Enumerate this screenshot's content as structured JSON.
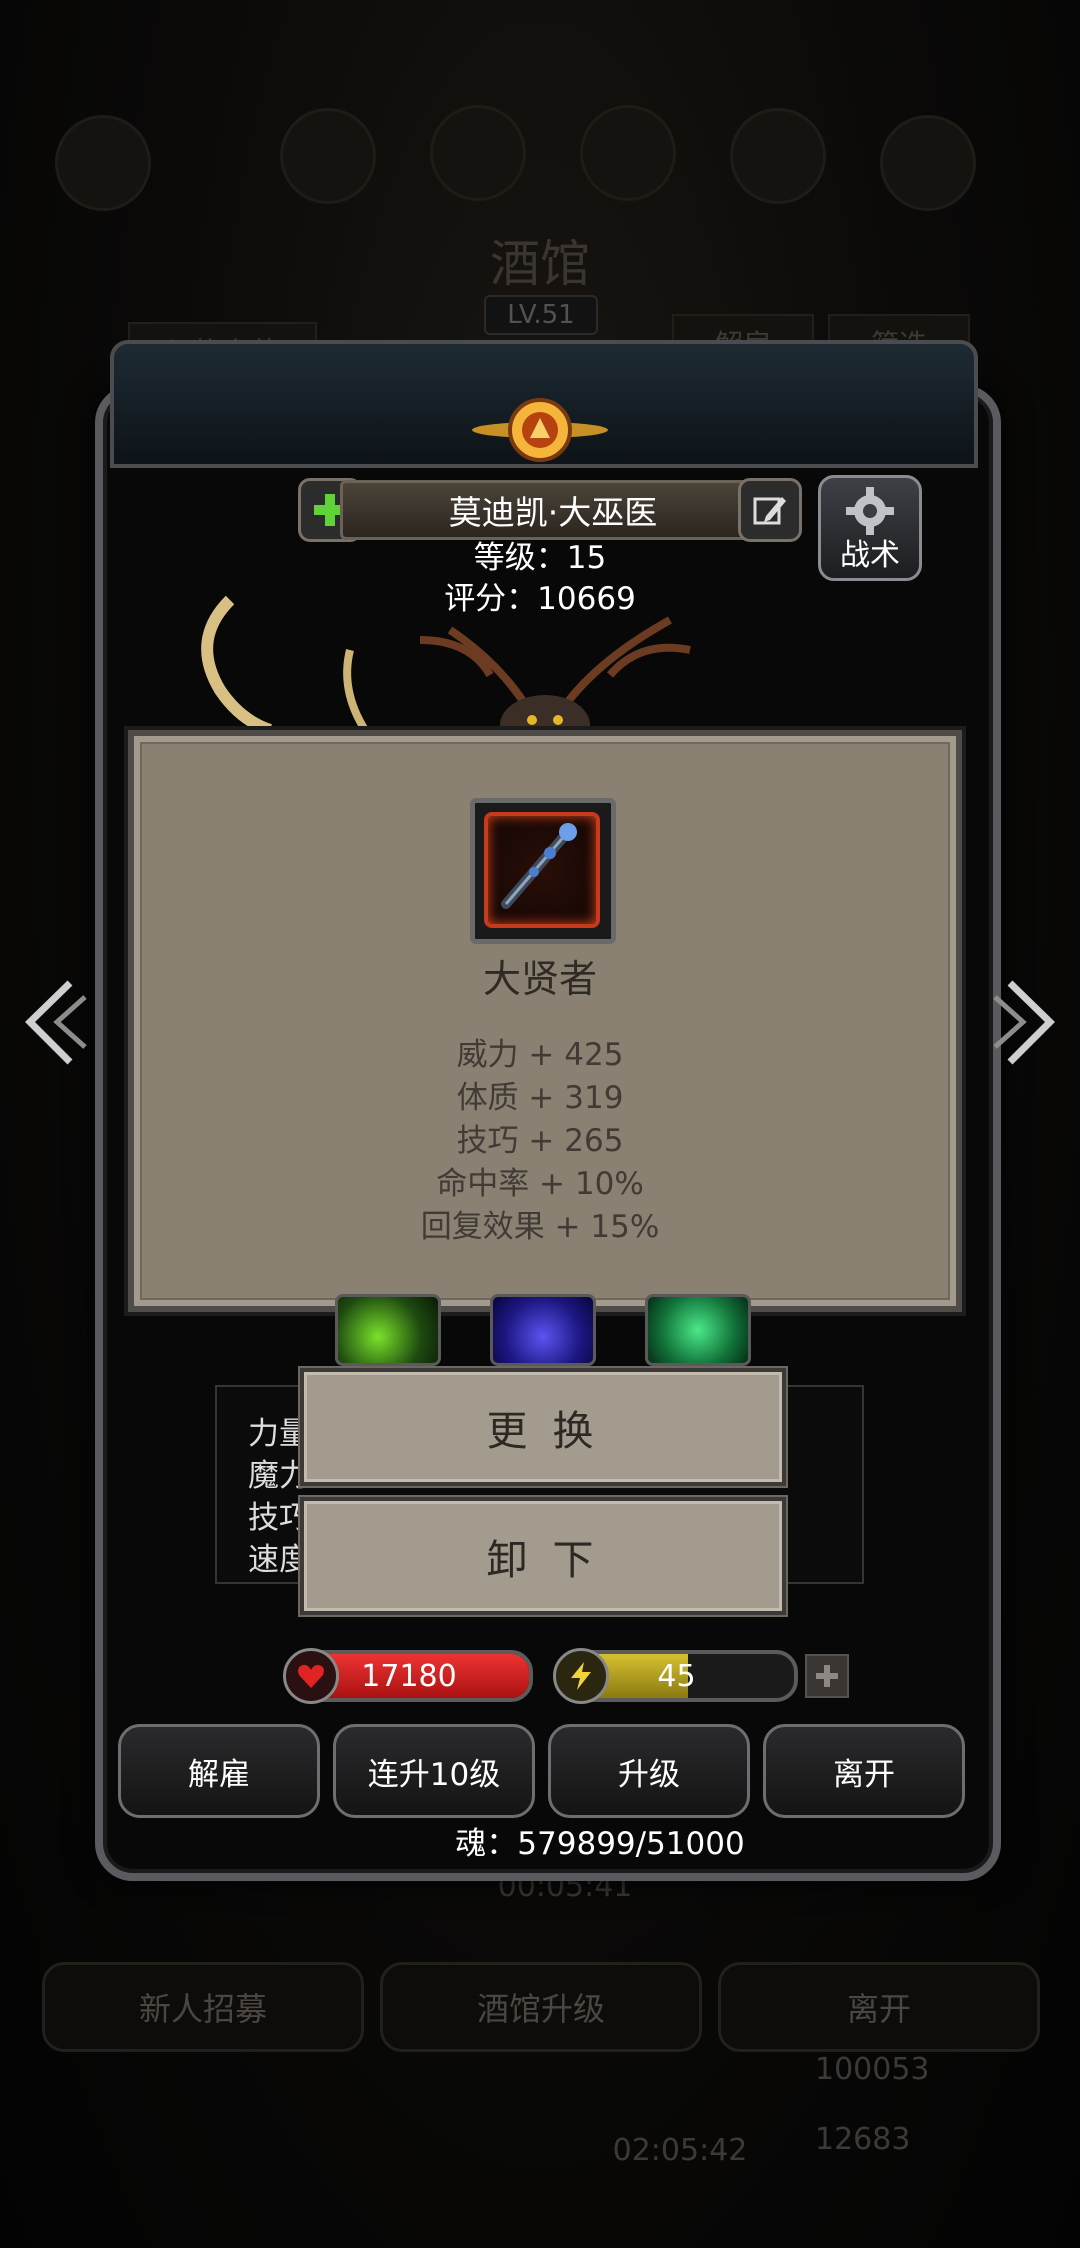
{
  "background": {
    "title": "酒馆",
    "level": "LV.51",
    "switch_set_label": "切换套装",
    "dismiss_label": "解雇",
    "filter_label": "筛选",
    "timer": "00:05:41",
    "bottom_buttons": [
      "新人招募",
      "酒馆升级",
      "离开"
    ],
    "lower_timer": "02:05:42",
    "resource1": "100053",
    "resource2": "12683"
  },
  "hero": {
    "name": "莫迪凯·大巫医",
    "level_line": "等级：15",
    "score_line": "评分：10669",
    "tactics_label": "战术"
  },
  "item_popup": {
    "name": "大贤者",
    "stats": [
      "威力 + 425",
      "体质 + 319",
      "技巧 + 265",
      "命中率 + 10%",
      "回复效果 + 15%"
    ]
  },
  "attributes": {
    "labels": [
      "力量",
      "魔力",
      "技巧",
      "速度"
    ]
  },
  "actions": {
    "replace_label": "更 换",
    "unequip_label": "卸 下"
  },
  "status": {
    "hp": "17180",
    "energy": "45",
    "energy_fill_fraction": 0.55,
    "hp_fill_fraction": 1.0,
    "soul": "魂：579899/51000"
  },
  "menu": {
    "dismiss": "解雇",
    "level_up_10": "连升10级",
    "level_up": "升级",
    "leave": "离开"
  },
  "colors": {
    "hp": "#dd2222",
    "energy": "#c9b52a",
    "popup_bg": "#8a8173"
  }
}
